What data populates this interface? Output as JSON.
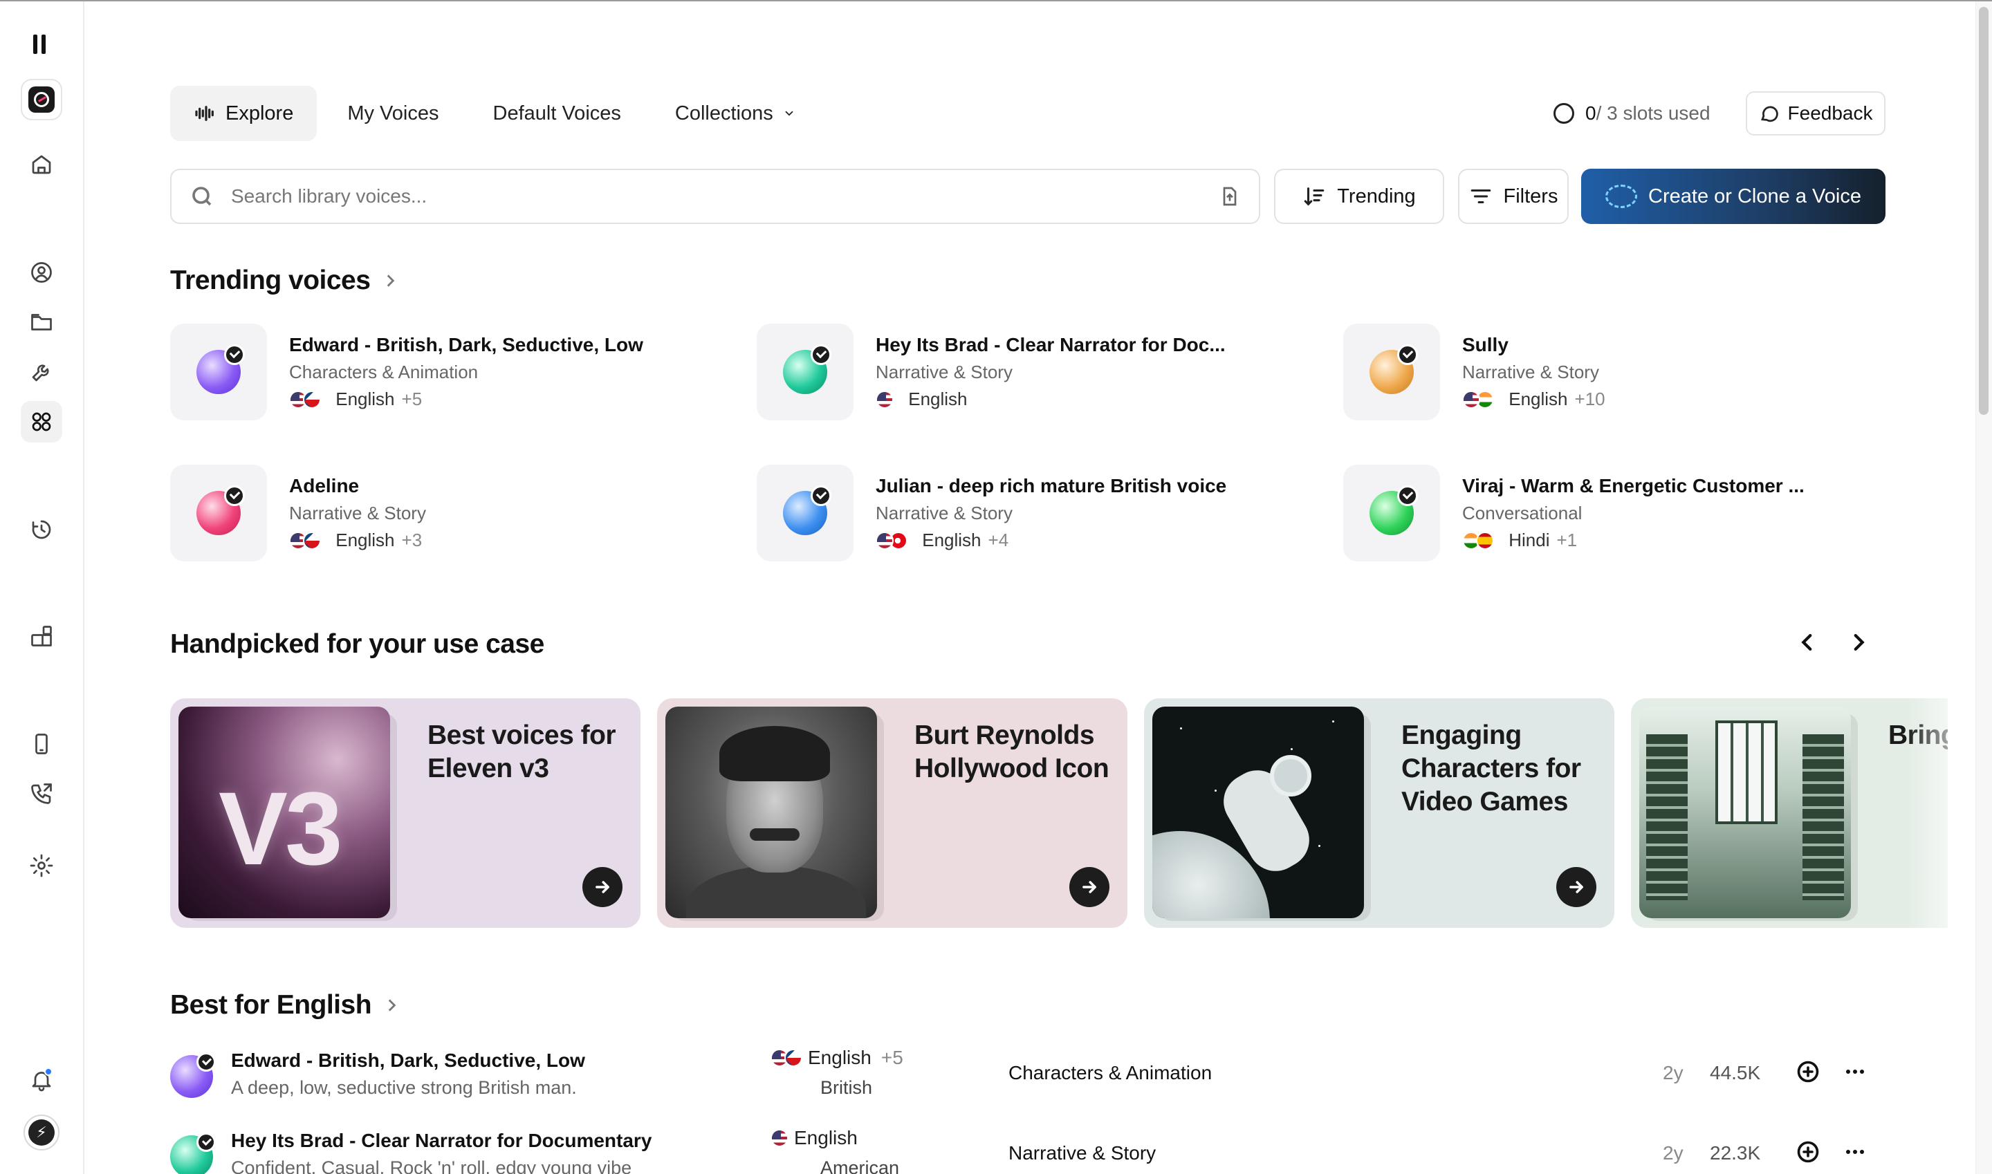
{
  "nav": {
    "tabs": [
      {
        "label": "Explore",
        "active": true
      },
      {
        "label": "My Voices"
      },
      {
        "label": "Default Voices"
      },
      {
        "label": "Collections"
      }
    ]
  },
  "header": {
    "slots_used": "0",
    "slots_total": "/ 3 slots used",
    "feedback_label": "Feedback"
  },
  "search": {
    "placeholder": "Search library voices..."
  },
  "toolbar": {
    "trending_label": "Trending",
    "filters_label": "Filters",
    "create_label": "Create or Clone a Voice"
  },
  "trending": {
    "title": "Trending voices",
    "items": [
      {
        "name": "Edward - British, Dark, Seductive, Low",
        "category": "Characters & Animation",
        "language": "English",
        "more": "+5",
        "orb": "#8a5cf6"
      },
      {
        "name": "Hey Its Brad - Clear Narrator for Doc...",
        "category": "Narrative & Story",
        "language": "English",
        "more": "",
        "orb": "#1fc99a"
      },
      {
        "name": "Sully",
        "category": "Narrative & Story",
        "language": "English",
        "more": "+10",
        "orb": "#f0a84c"
      },
      {
        "name": "Adeline",
        "category": "Narrative & Story",
        "language": "English",
        "more": "+3",
        "orb": "#f0447a"
      },
      {
        "name": "Julian - deep rich mature British voice",
        "category": "Narrative & Story",
        "language": "English",
        "more": "+4",
        "orb": "#3d8ff0"
      },
      {
        "name": "Viraj - Warm & Energetic Customer ...",
        "category": "Conversational",
        "language": "Hindi",
        "more": "+1",
        "orb": "#2fd35a"
      }
    ]
  },
  "handpicked": {
    "title": "Handpicked for your use case",
    "cards": [
      {
        "title": "Best voices for Eleven v3",
        "image_text": "V3",
        "bg": "#e6dbe9"
      },
      {
        "title": "Burt Reynolds Hollywood Icon",
        "bg": "#ecdce0"
      },
      {
        "title": "Engaging Characters for Video Games",
        "bg": "#dfe7e7"
      },
      {
        "title": "Bring stories",
        "bg": "#e3ece5"
      }
    ]
  },
  "best_english": {
    "title": "Best for English",
    "rows": [
      {
        "name": "Edward - British, Dark, Seductive, Low",
        "description": "A deep, low, seductive strong British man.",
        "language": "English",
        "more": "+5",
        "accent": "British",
        "category": "Characters & Animation",
        "age": "2y",
        "usage": "44.5K"
      },
      {
        "name": "Hey Its Brad - Clear Narrator for Documentary",
        "description": "Confident, Casual, Rock 'n' roll, edgy young vibe",
        "language": "English",
        "more": "",
        "accent": "American",
        "category": "Narrative & Story",
        "age": "2y",
        "usage": "22.3K"
      }
    ]
  }
}
